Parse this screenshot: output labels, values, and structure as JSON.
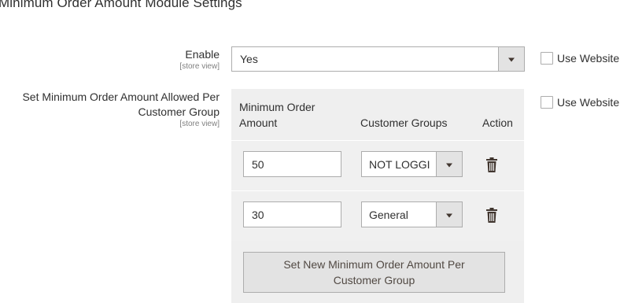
{
  "section": {
    "title": "Minimum Order Amount Module Settings"
  },
  "enable": {
    "label": "Enable",
    "scope": "[store view]",
    "value": "Yes",
    "use_website": "Use Website"
  },
  "min_order": {
    "label": "Set Minimum Order Amount Allowed Per Customer Group",
    "scope": "[store view]",
    "use_website": "Use Website",
    "headers": {
      "amount": "Minimum Order Amount",
      "groups": "Customer Groups",
      "action": "Action"
    },
    "rows": [
      {
        "amount": "50",
        "group": "NOT LOGGI"
      },
      {
        "amount": "30",
        "group": "General"
      }
    ],
    "add_button": "Set New Minimum Order Amount Per Customer Group"
  },
  "icons": {
    "select_arrow": "chevron-down-icon",
    "delete": "trash-icon",
    "checkbox": "checkbox-icon"
  },
  "colors": {
    "grid_bg": "#efefef",
    "button_bg": "#e3e3e3",
    "border": "#adadad",
    "icon": "#41362f"
  }
}
